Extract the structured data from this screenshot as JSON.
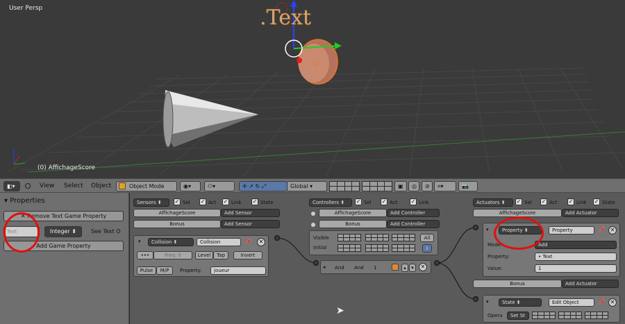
{
  "viewport": {
    "view_label": "User Persp",
    "object_label": "(0) AffichageScore",
    "text_object": ".Text"
  },
  "header": {
    "menus": [
      "View",
      "Select",
      "Object"
    ],
    "mode": "Object Mode",
    "orientation": "Global"
  },
  "properties": {
    "title": "Properties",
    "remove_button": "Remove Text Game Property",
    "prop_name": "Text",
    "prop_type": "Integer",
    "see_text": "See Text O",
    "add_button": "Add Game Property"
  },
  "logic": {
    "sensors": {
      "menu": "Sensors",
      "flags": [
        "Sel",
        "Act",
        "Link",
        "State"
      ],
      "rows": [
        {
          "name": "AffichageScore",
          "add": "Add Sensor"
        },
        {
          "name": "Bonus",
          "add": "Add Sensor"
        }
      ],
      "brick": {
        "type": "Collision",
        "name": "Collision",
        "freq": "Freq: 0",
        "level": "Level",
        "tap": "Tap",
        "invert": "Invert",
        "pulse": "Pulse",
        "mp": "M/P",
        "property_label": "Property:",
        "property_value": "joueur"
      }
    },
    "controllers": {
      "menu": "Controllers",
      "flags": [
        "Sel",
        "Act",
        "Link"
      ],
      "rows": [
        {
          "name": "AffichageScore",
          "add": "Add Controller"
        },
        {
          "name": "Bonus",
          "add": "Add Controller"
        }
      ],
      "visible": "Visible",
      "initial": "Initial",
      "all": "All",
      "brick": {
        "type": "And",
        "name": "And",
        "num": "1"
      }
    },
    "actuators": {
      "menu": "Actuators",
      "flags": [
        "Sel",
        "Act",
        "Link",
        "State"
      ],
      "rows": [
        {
          "name": "AffichageScore",
          "add": "Add Actuator"
        },
        {
          "name": "Bonus",
          "add": "Add Actuator"
        }
      ],
      "brick1": {
        "type": "Property",
        "name": "Property",
        "mode_label": "Mode:",
        "mode": "Add",
        "property_label": "Property:",
        "property": "Text",
        "value_label": "Value:",
        "value": "1"
      },
      "brick2": {
        "type": "State",
        "name": "Edit Object",
        "op_label": "Opera",
        "op": "Set St"
      }
    }
  }
}
